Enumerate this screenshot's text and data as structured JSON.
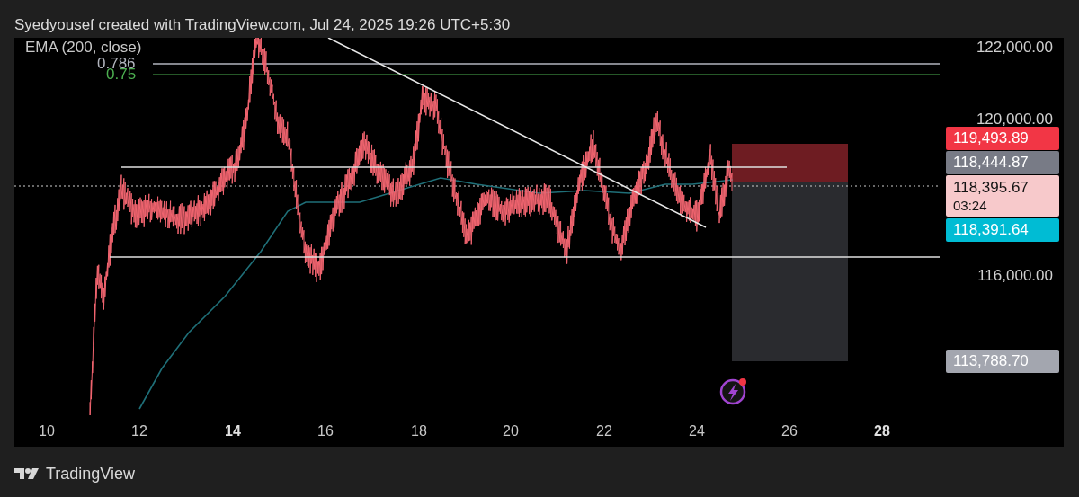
{
  "credit": "Syedyousef created with TradingView.com, Jul 24, 2025 19:26 UTC+5:30",
  "legend": {
    "indicator": "EMA (200, close)"
  },
  "fib_levels": [
    {
      "label": "0.786",
      "color": "#b2b5be"
    },
    {
      "label": "0.75",
      "color": "#4caf50"
    }
  ],
  "price_axis": [
    "122,000.00",
    "120,000.00",
    "116,000.00"
  ],
  "price_tags": [
    {
      "value": "119,493.89",
      "color": "#f23645"
    },
    {
      "value": "118,444.87",
      "color": "#787b86"
    },
    {
      "value": "118,395.67",
      "countdown": "03:24",
      "color": "#f7c9cb"
    },
    {
      "value": "118,391.64",
      "color": "#00bcd4"
    },
    {
      "value": "113,788.70",
      "color": "#a3a6af"
    }
  ],
  "time_axis": [
    {
      "label": "10",
      "emphasized": false
    },
    {
      "label": "12",
      "emphasized": false
    },
    {
      "label": "14",
      "emphasized": true
    },
    {
      "label": "16",
      "emphasized": false
    },
    {
      "label": "18",
      "emphasized": false
    },
    {
      "label": "20",
      "emphasized": false
    },
    {
      "label": "22",
      "emphasized": false
    },
    {
      "label": "24",
      "emphasized": false
    },
    {
      "label": "26",
      "emphasized": false
    },
    {
      "label": "28",
      "emphasized": true
    }
  ],
  "footer": {
    "brand": "TradingView"
  }
}
